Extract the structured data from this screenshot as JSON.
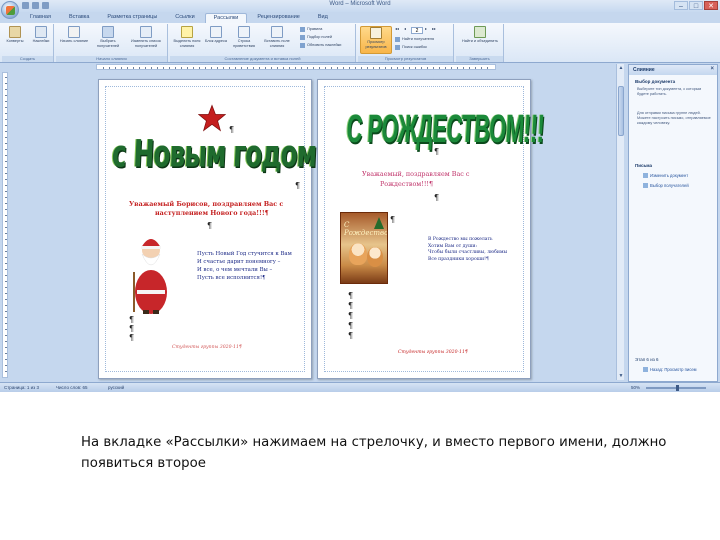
{
  "window": {
    "title": "Word – Microsoft Word",
    "controls": [
      "–",
      "□",
      "✕"
    ]
  },
  "ribbon": {
    "tabs": [
      {
        "label": "Главная"
      },
      {
        "label": "Вставка"
      },
      {
        "label": "Разметка страницы"
      },
      {
        "label": "Ссылки"
      },
      {
        "label": "Рассылки",
        "active": true
      },
      {
        "label": "Рецензирование"
      },
      {
        "label": "Вид"
      }
    ],
    "groups": [
      {
        "label": "Создать",
        "buttons": [
          "Конверты",
          "Наклейки"
        ]
      },
      {
        "label": "Начало слияния",
        "buttons": [
          "Начать слияние",
          "Выбрать получателей",
          "Изменить список получателей"
        ]
      },
      {
        "label": "Составление документа и вставка полей",
        "buttons": [
          "Выделить поля слияния",
          "Блок адреса",
          "Строка приветствия",
          "Вставить поле слияния"
        ]
      },
      {
        "label": "Просмотр результатов",
        "buttons": [
          "Просмотр результатов"
        ],
        "record": "2"
      },
      {
        "label": "Завершить",
        "buttons": [
          "Найти и объединить"
        ]
      }
    ],
    "small_items": {
      "rules": "Правила",
      "match": "Подбор полей",
      "update": "Обновить наклейки",
      "find_recipient": "Найти получателя",
      "check_errors": "Поиск ошибок"
    }
  },
  "document": {
    "page1": {
      "title": "с Новым годом!",
      "greeting_line1": "Уважаемый Борисов, поздравляем Вас с",
      "greeting_line2": "наступлением Нового года!!!¶",
      "poem": [
        "Пусть Новый Год стучится к Вам",
        "И счастье дарит понемногу –",
        "И все, о чем мечтали Вы –",
        "Пусть все исполнится!¶"
      ],
      "footer": "Студенты группы 3020-11¶"
    },
    "page2": {
      "title": "С РОЖДЕСТВОМ!!!",
      "greeting_line1": "Уважаемый, поздравляем Вас с",
      "greeting_line2": "Рождеством!!!¶",
      "card_text": "С Рождеством",
      "poem": [
        "В Рождество мы пожелать",
        "Хотим Вам от души:",
        "Чтобы были счастливы, любимы",
        "Все праздники хороши!¶"
      ],
      "footer": "Студенты группы 3020-11¶"
    }
  },
  "sidepane": {
    "title": "Слияние",
    "close": "×",
    "section1": "Выбор документа",
    "text1": "Выберите тип документа, с которым будете работать.",
    "text2": "Для отправки письма группе людей. Можете настроить письмо, отправляемое каждому человеку.",
    "section2": "Письма",
    "links": [
      "Изменить документ",
      "Выбор получателей"
    ],
    "step": "Этап 6 из 6",
    "prev_link": "Назад: Просмотр писем"
  },
  "statusbar": {
    "page": "Страница: 1 из 3",
    "words": "Число слов: 65",
    "lang": "русский",
    "zoom": "50%"
  },
  "caption": "На вкладке «Рассылки» нажимаем на стрелочку, и вместо первого имени, должно появиться второе"
}
